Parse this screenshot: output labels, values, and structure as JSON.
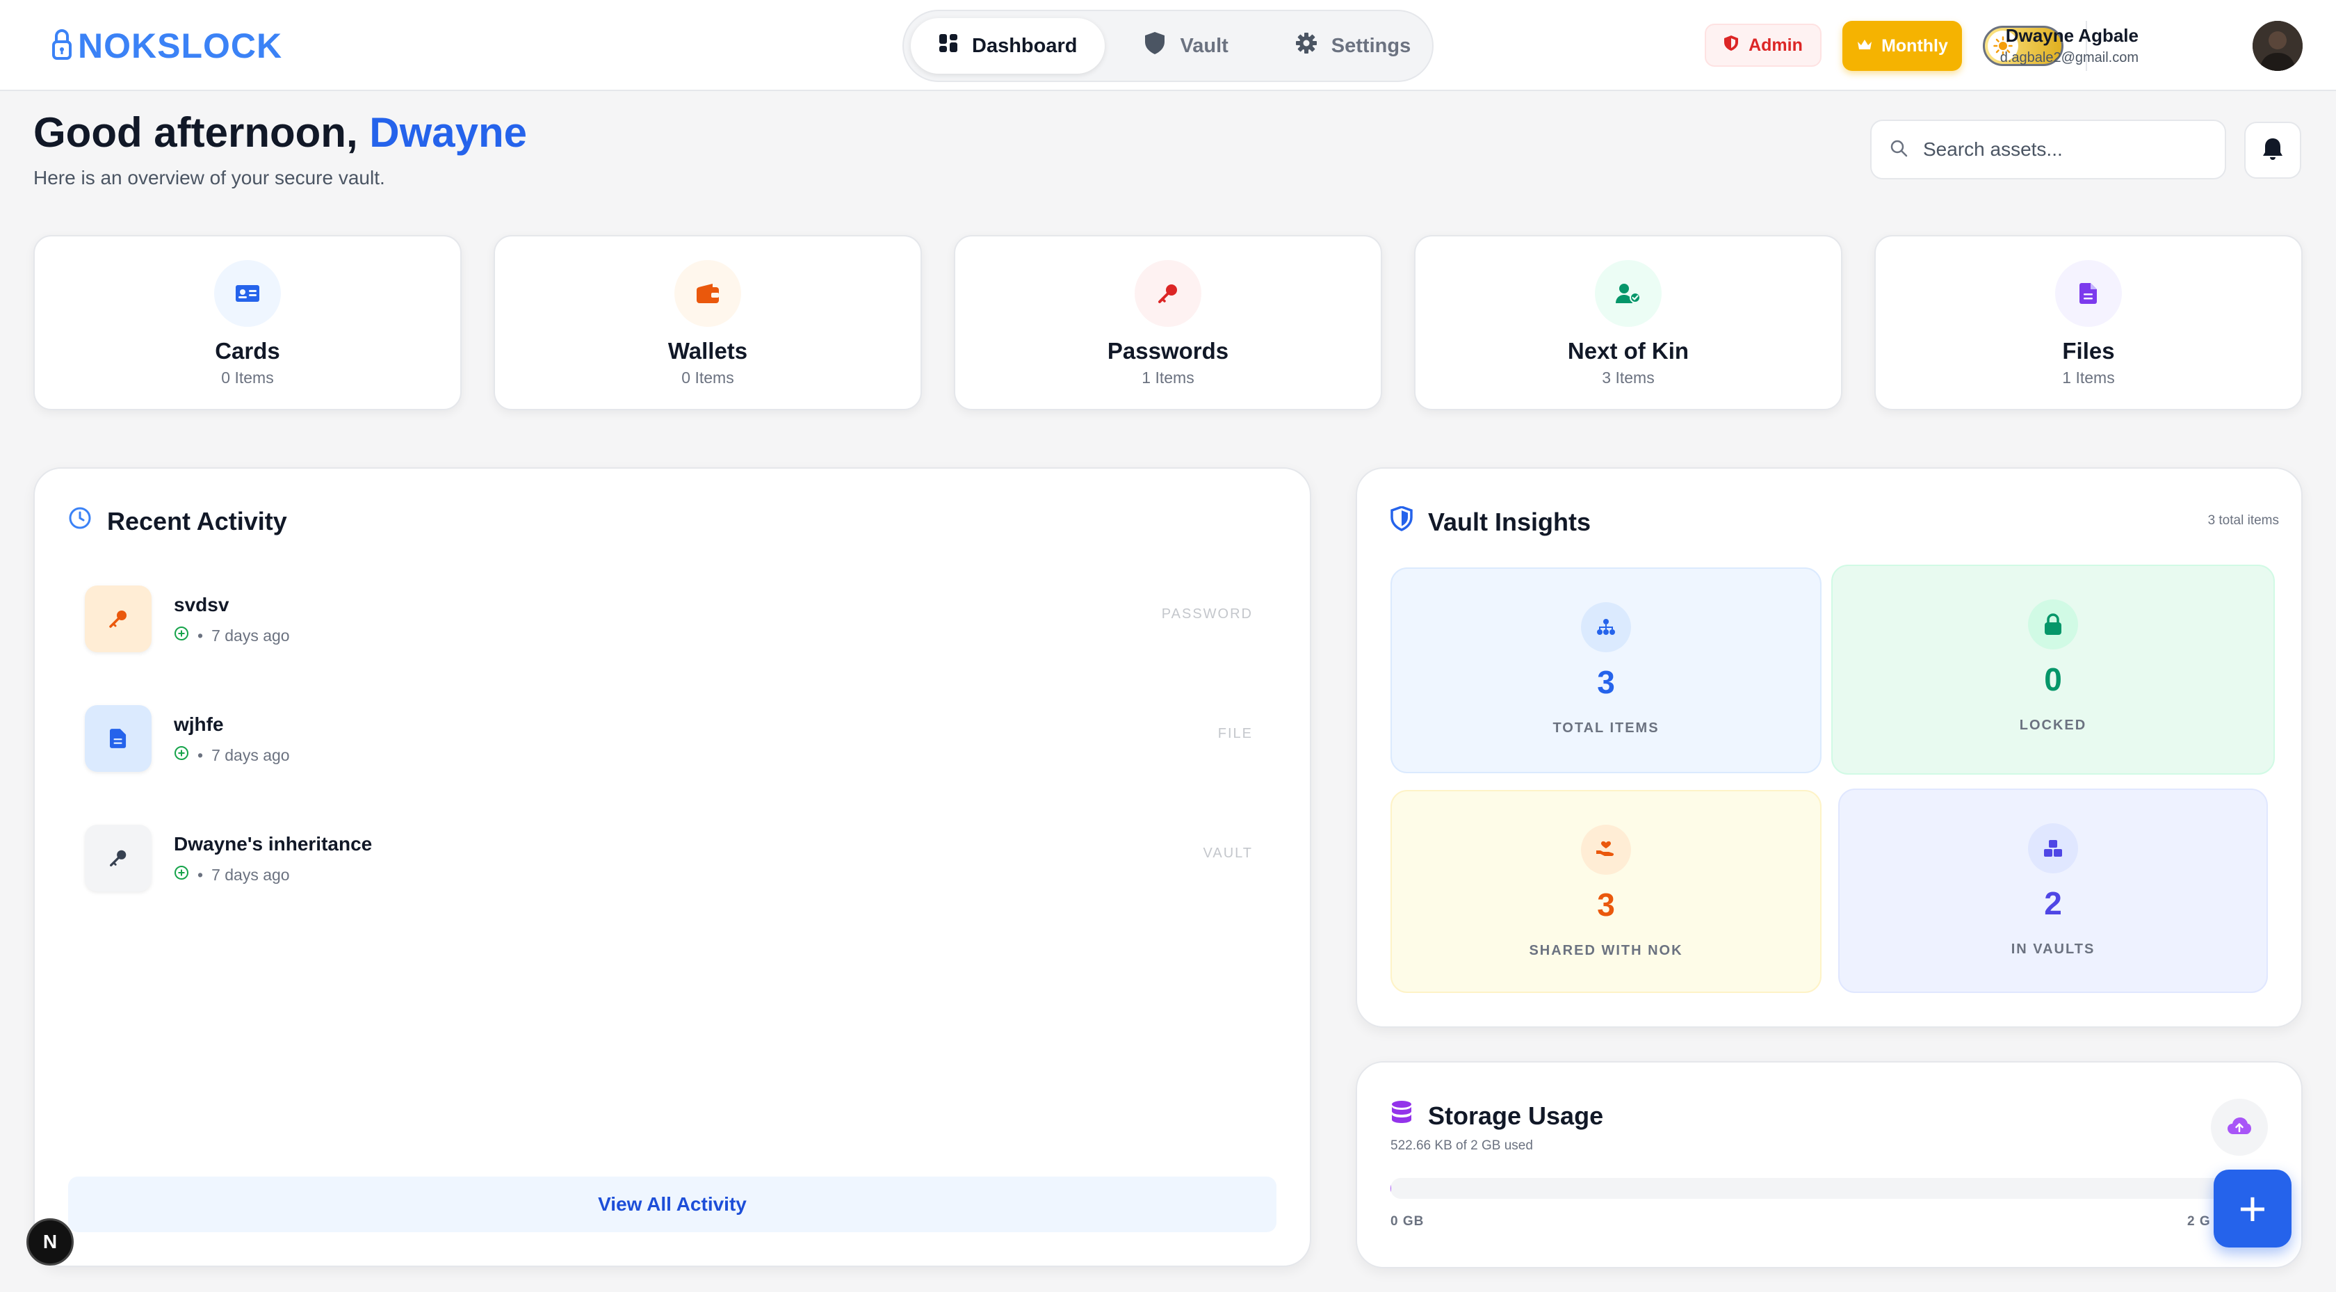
{
  "brand": {
    "name": "NOKSLOCK",
    "color": "#3b82f6"
  },
  "nav": {
    "items": [
      {
        "label": "Dashboard",
        "icon": "grid-icon",
        "active": true
      },
      {
        "label": "Vault",
        "icon": "shield-icon",
        "active": false
      },
      {
        "label": "Settings",
        "icon": "gear-icon",
        "active": false
      }
    ]
  },
  "header": {
    "admin_label": "Admin",
    "plan_label": "Monthly",
    "theme": "light",
    "user": {
      "name": "Dwayne Agbale",
      "email": "d.agbale2@gmail.com"
    }
  },
  "greeting": {
    "prefix": "Good afternoon,",
    "name": "Dwayne",
    "subtitle": "Here is an overview of your secure vault."
  },
  "search": {
    "placeholder": "Search assets..."
  },
  "categories": [
    {
      "title": "Cards",
      "count": "0 Items",
      "icon": "id-card-icon",
      "color": "#2563eb",
      "bg": "#eff6ff"
    },
    {
      "title": "Wallets",
      "count": "0 Items",
      "icon": "wallet-icon",
      "color": "#ea580c",
      "bg": "#fff7ed"
    },
    {
      "title": "Passwords",
      "count": "1 Items",
      "icon": "key-icon",
      "color": "#dc2626",
      "bg": "#fef2f2"
    },
    {
      "title": "Next of Kin",
      "count": "3 Items",
      "icon": "user-check-icon",
      "color": "#059669",
      "bg": "#ecfdf5"
    },
    {
      "title": "Files",
      "count": "1 Items",
      "icon": "file-icon",
      "color": "#7c3aed",
      "bg": "#f5f3ff"
    }
  ],
  "recent_activity": {
    "title": "Recent Activity",
    "items": [
      {
        "title": "svdsv",
        "time": "7 days ago",
        "type": "PASSWORD",
        "icon": "key-icon"
      },
      {
        "title": "wjhfe",
        "time": "7 days ago",
        "type": "FILE",
        "icon": "file-icon"
      },
      {
        "title": "Dwayne's inheritance",
        "time": "7 days ago",
        "type": "VAULT",
        "icon": "key-icon"
      }
    ],
    "view_all_label": "View All Activity"
  },
  "vault_insights": {
    "title": "Vault Insights",
    "total_label": "3 total items",
    "tiles": [
      {
        "value": "3",
        "label": "TOTAL ITEMS",
        "icon": "network-icon",
        "color": "#2563eb"
      },
      {
        "value": "0",
        "label": "LOCKED",
        "icon": "lock-icon",
        "color": "#059669"
      },
      {
        "value": "3",
        "label": "SHARED WITH NOK",
        "icon": "hand-heart-icon",
        "color": "#ea580c"
      },
      {
        "value": "2",
        "label": "IN VAULTS",
        "icon": "boxes-icon",
        "color": "#4f46e5"
      }
    ]
  },
  "storage": {
    "title": "Storage Usage",
    "used_label": "522.66 KB of 2 GB used",
    "used_fraction": 0.00025,
    "min_label": "0 GB",
    "max_label": "2 G"
  },
  "fab_label": "+",
  "dev_badge": "N"
}
